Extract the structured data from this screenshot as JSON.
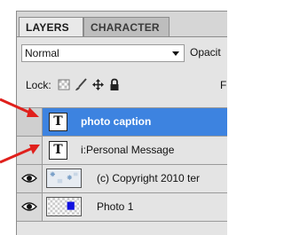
{
  "tabs": [
    {
      "label": "LAYERS"
    },
    {
      "label": "CHARACTER"
    }
  ],
  "blend_mode": {
    "value": "Normal"
  },
  "opacity": {
    "label": "Opacit"
  },
  "lock": {
    "label": "Lock:"
  },
  "fill": {
    "label": "F"
  },
  "layers": [
    {
      "name": "photo caption",
      "type": "text",
      "selected": true
    },
    {
      "name": "i:Personal Message",
      "type": "text",
      "selected": false
    },
    {
      "name": "(c) Copyright 2010 ter",
      "type": "image",
      "selected": false
    },
    {
      "name": "Photo 1",
      "type": "image",
      "selected": false
    }
  ],
  "icons": [
    "lock-transparent-icon",
    "lock-brush-icon",
    "lock-move-icon",
    "lock-all-icon",
    "eye-icon",
    "text-layer-icon"
  ],
  "colors": {
    "selection": "#3d83e0",
    "annotation": "#e0201c"
  }
}
